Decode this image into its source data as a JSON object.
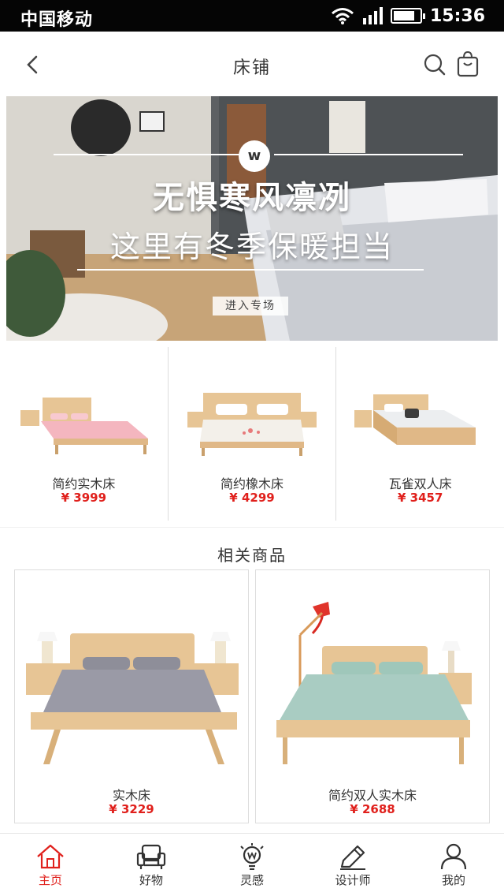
{
  "status_bar": {
    "carrier": "中国移动",
    "time": "15:36",
    "battery_level": 0.8
  },
  "nav": {
    "title": "床铺"
  },
  "banner": {
    "logo": "w",
    "headline": "无惧寒风凛冽",
    "subline": "这里有冬季保暖担当",
    "cta": "进入专场"
  },
  "featured": [
    {
      "name": "简约实木床",
      "price": "¥ 3999",
      "sheet_color": "#f4b6bf"
    },
    {
      "name": "简约橡木床",
      "price": "¥ 4299",
      "sheet_color": "#f3f0ea"
    },
    {
      "name": "瓦雀双人床",
      "price": "¥ 3457",
      "sheet_color": "#eceef0"
    }
  ],
  "related": {
    "title": "相关商品",
    "items": [
      {
        "name": "实木床",
        "price": "¥ 3229",
        "sheet_color": "#9a9aa6"
      },
      {
        "name": "简约双人实木床",
        "price": "¥ 2688",
        "sheet_color": "#a9ccc2"
      }
    ]
  },
  "tabs": [
    {
      "label": "主页",
      "icon": "home-icon",
      "active": true
    },
    {
      "label": "好物",
      "icon": "armchair-icon",
      "active": false
    },
    {
      "label": "灵感",
      "icon": "lightbulb-icon",
      "active": false
    },
    {
      "label": "设计师",
      "icon": "pencil-icon",
      "active": false
    },
    {
      "label": "我的",
      "icon": "person-icon",
      "active": false
    }
  ],
  "colors": {
    "accent": "#e0201c",
    "wood": "#e7c595",
    "text": "#333333"
  }
}
